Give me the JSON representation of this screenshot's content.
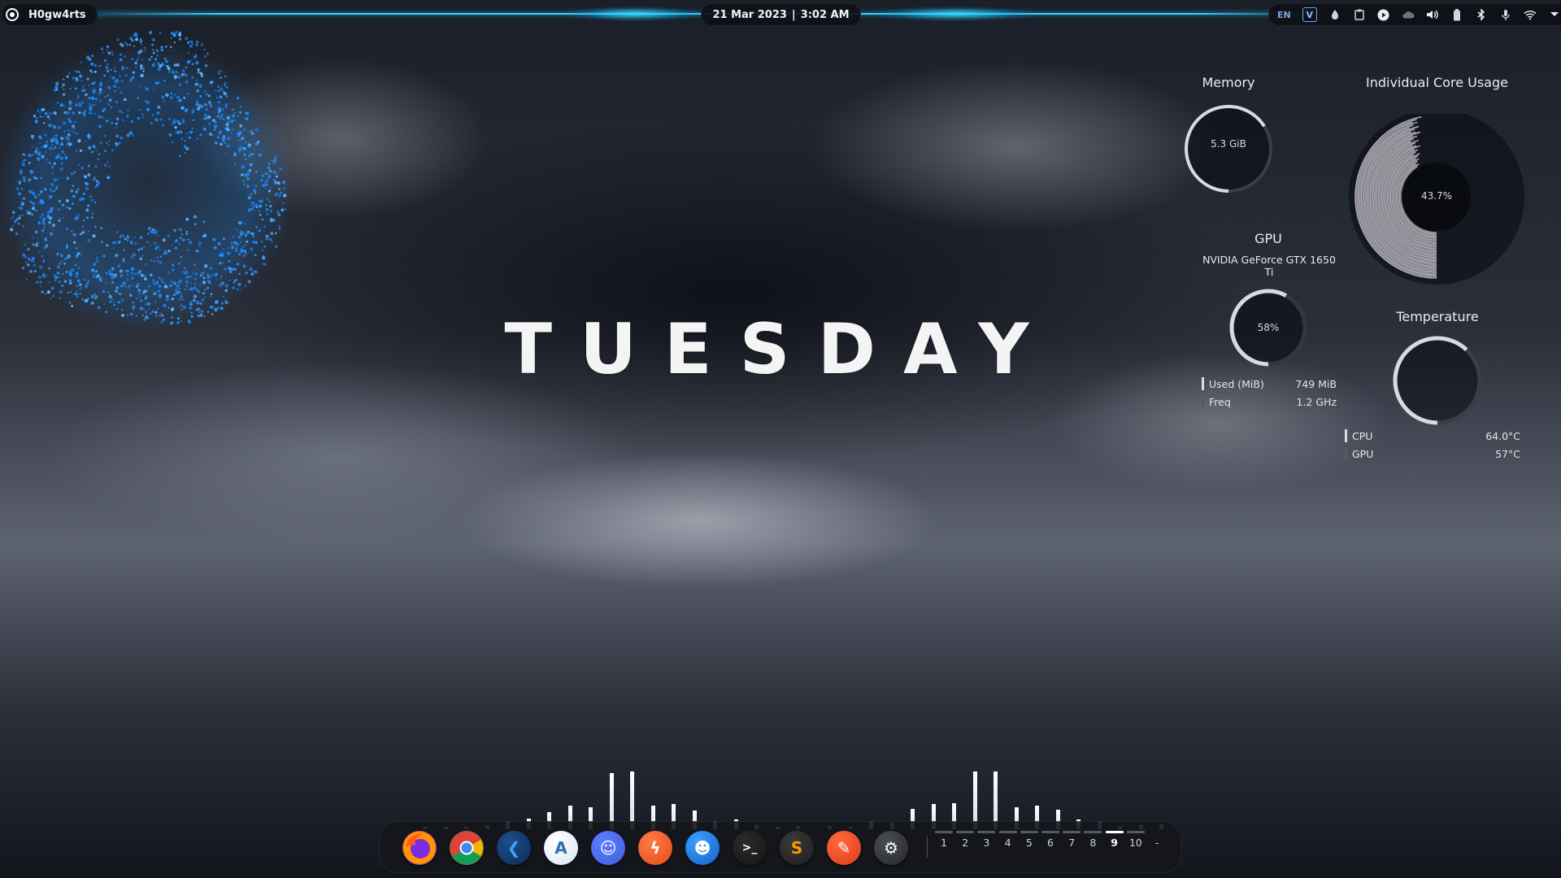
{
  "topbar": {
    "launcher_label": "H0gw4rts",
    "date": "21 Mar 2023",
    "separator": "|",
    "time": "3:02 AM",
    "tray": {
      "language": "EN",
      "vpn_glyph": "V",
      "icons": [
        "language-indicator",
        "v-app-icon",
        "color-picker-icon",
        "clipboard-icon",
        "media-play-icon",
        "cloud-icon",
        "volume-icon",
        "battery-icon",
        "bluetooth-icon",
        "microphone-icon",
        "wifi-icon",
        "arrow-down-icon"
      ]
    }
  },
  "desktop": {
    "day_text": "TUESDAY"
  },
  "widgets": {
    "memory": {
      "title": "Memory",
      "value": "5.3 GiB",
      "fraction": 0.66
    },
    "core_usage": {
      "title": "Individual Core Usage",
      "value": "43.7%",
      "fraction": 0.437
    },
    "gpu": {
      "title": "GPU",
      "model": "NVIDIA GeForce GTX 1650 Ti",
      "value": "58%",
      "fraction": 0.58,
      "rows": [
        {
          "label": "Used (MiB)",
          "value": "749 MiB",
          "color": "#d9dde3"
        },
        {
          "label": "Freq",
          "value": "1.2 GHz",
          "color": "#555a63"
        }
      ]
    },
    "temperature": {
      "title": "Temperature",
      "fraction": 0.62,
      "rows": [
        {
          "label": "CPU",
          "value": "64.0°C",
          "color": "#d9dde3"
        },
        {
          "label": "GPU",
          "value": "57°C",
          "color": "#555a63"
        }
      ]
    }
  },
  "visualizer": {
    "left_levels": [
      0.03,
      0.02,
      0.03,
      0.05,
      0.1,
      0.14,
      0.22,
      0.3,
      0.28,
      0.72,
      0.74,
      0.3,
      0.32,
      0.24,
      0.1,
      0.12,
      0.05,
      0.03,
      0.04
    ],
    "right_levels": [
      0.04,
      0.03,
      0.1,
      0.08,
      0.26,
      0.32,
      0.33,
      0.74,
      0.74,
      0.28,
      0.3,
      0.25,
      0.13,
      0.1,
      0.04,
      0.05,
      0.06
    ]
  },
  "dock": {
    "apps": [
      {
        "name": "firefox-icon",
        "glyph": "",
        "bg": "#ff7a18",
        "bg2": "#6a2bd9"
      },
      {
        "name": "chrome-icon",
        "glyph": "",
        "bg": "#e94235",
        "bg2": "#34a853"
      },
      {
        "name": "vscode-icon",
        "glyph": "❮",
        "bg": "#1d4e8f",
        "bg2": "#0d2a55"
      },
      {
        "name": "android-studio-icon",
        "glyph": "A",
        "bg": "#ffffff",
        "bg2": "#d8e6f3"
      },
      {
        "name": "discord-icon",
        "glyph": "☺",
        "bg": "#5b7cff",
        "bg2": "#3f5fe0"
      },
      {
        "name": "lightning-app-icon",
        "glyph": "ϟ",
        "bg": "#ff7a45",
        "bg2": "#e54d1c"
      },
      {
        "name": "finder-icon",
        "glyph": "☻",
        "bg": "#3aa0ff",
        "bg2": "#1560c9"
      },
      {
        "name": "terminal-icon",
        "glyph": ">_",
        "bg": "#2b2b2b",
        "bg2": "#151515"
      },
      {
        "name": "sublime-text-icon",
        "glyph": "S",
        "bg": "#3a3a3a",
        "bg2": "#1e1e1e"
      },
      {
        "name": "text-editor-icon",
        "glyph": "✎",
        "bg": "#ff6a3d",
        "bg2": "#e0391c"
      },
      {
        "name": "settings-icon",
        "glyph": "⚙",
        "bg": "#4a4d52",
        "bg2": "#26282c"
      }
    ],
    "workspaces": [
      "1",
      "2",
      "3",
      "4",
      "5",
      "6",
      "7",
      "8",
      "9",
      "10",
      "-"
    ],
    "active_workspace": "9"
  }
}
